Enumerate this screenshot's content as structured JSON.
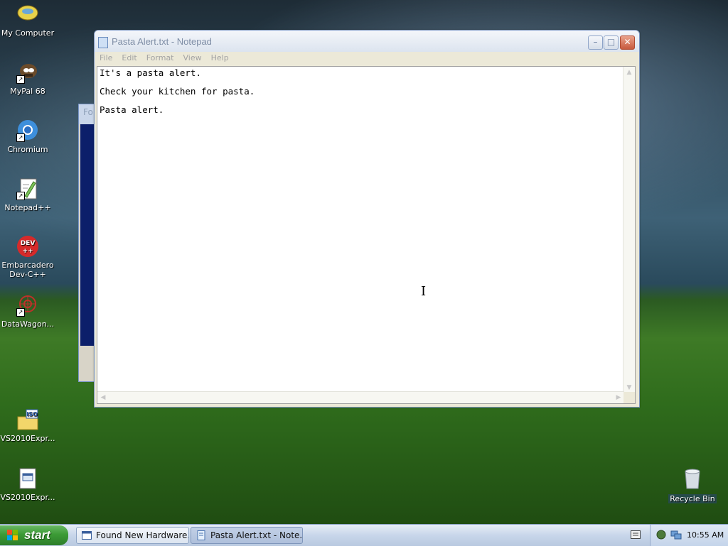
{
  "desktop": {
    "icons": [
      {
        "label": "My Computer"
      },
      {
        "label": "MyPal 68"
      },
      {
        "label": "Chromium"
      },
      {
        "label": "Notepad++"
      },
      {
        "label_line1": "Embarcadero",
        "label_line2": "Dev-C++",
        "badge": "DEV\n++"
      },
      {
        "label": "DataWagon..."
      },
      {
        "label": "VS2010Expr...",
        "badge": "ISO"
      },
      {
        "label": "VS2010Expr..."
      }
    ],
    "recycle_bin": {
      "label": "Recycle Bin"
    }
  },
  "background_window": {
    "title_fragment": "Fo"
  },
  "notepad": {
    "title": "Pasta Alert.txt - Notepad",
    "menu": [
      "File",
      "Edit",
      "Format",
      "View",
      "Help"
    ],
    "content_lines": [
      "It's a pasta alert.",
      "Check your kitchen for pasta.",
      "Pasta alert."
    ],
    "controls": {
      "minimize": "–",
      "maximize": "□",
      "close": "✕"
    }
  },
  "taskbar": {
    "start_label": "start",
    "tasks": [
      {
        "label": "Found New Hardware...",
        "active": false
      },
      {
        "label": "Pasta Alert.txt - Note...",
        "active": true
      }
    ],
    "clock": "10:55 AM"
  },
  "colors": {
    "start_green": "#3c9b36",
    "taskbar_blue": "#c8d6ea",
    "close_red": "#c75a3e"
  }
}
